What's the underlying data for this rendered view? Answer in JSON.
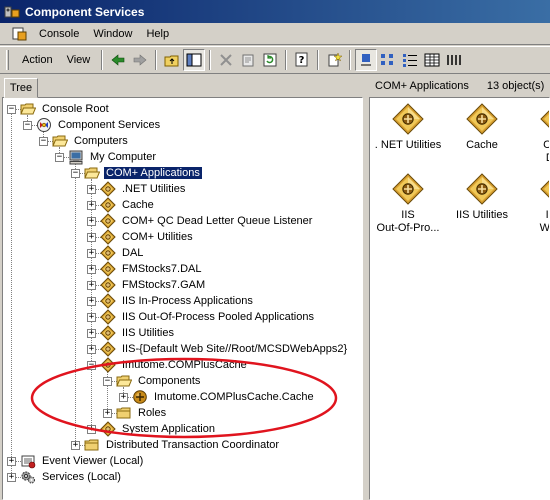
{
  "window": {
    "title": "Component Services"
  },
  "menubar": {
    "items": [
      "Console",
      "Window",
      "Help"
    ]
  },
  "toolbar": {
    "action_label": "Action",
    "view_label": "View"
  },
  "left_pane": {
    "tab_label": "Tree",
    "nodes": [
      {
        "label": "Console Root",
        "icon": "folder-open-icon"
      },
      {
        "label": "Component Services",
        "icon": "component-services-icon"
      },
      {
        "label": "Computers",
        "icon": "folder-open-icon"
      },
      {
        "label": "My Computer",
        "icon": "computer-icon"
      },
      {
        "label": "COM+ Applications",
        "icon": "folder-open-icon"
      },
      {
        "label": ".NET Utilities",
        "icon": "com-package-icon"
      },
      {
        "label": "Cache",
        "icon": "com-package-icon"
      },
      {
        "label": "COM+ QC Dead Letter Queue Listener",
        "icon": "com-package-icon"
      },
      {
        "label": "COM+ Utilities",
        "icon": "com-package-icon"
      },
      {
        "label": "DAL",
        "icon": "com-package-icon"
      },
      {
        "label": "FMStocks7.DAL",
        "icon": "com-package-icon"
      },
      {
        "label": "FMStocks7.GAM",
        "icon": "com-package-icon"
      },
      {
        "label": "IIS In-Process Applications",
        "icon": "com-package-icon"
      },
      {
        "label": "IIS Out-Of-Process Pooled Applications",
        "icon": "com-package-icon"
      },
      {
        "label": "IIS Utilities",
        "icon": "com-package-icon"
      },
      {
        "label": "IIS-{Default Web Site//Root/MCSDWebApps2}",
        "icon": "com-package-icon"
      },
      {
        "label": "Imutome.COMPlusCache",
        "icon": "com-package-icon"
      },
      {
        "label": "Components",
        "icon": "folder-open-icon"
      },
      {
        "label": "Imutome.COMPlusCache.Cache",
        "icon": "component-ball-icon"
      },
      {
        "label": "Roles",
        "icon": "folder-icon"
      },
      {
        "label": "System Application",
        "icon": "com-package-icon"
      },
      {
        "label": "Distributed Transaction Coordinator",
        "icon": "folder-icon"
      },
      {
        "label": "Event Viewer (Local)",
        "icon": "event-viewer-icon"
      },
      {
        "label": "Services (Local)",
        "icon": "services-gear-icon"
      }
    ]
  },
  "right_pane": {
    "header_title": "COM+ Applications",
    "header_count": "13 object(s)",
    "items": [
      {
        "line1": ". NET Utilities",
        "line2": ""
      },
      {
        "line1": "Cache",
        "line2": ""
      },
      {
        "line1": "COM",
        "line2": "Dea"
      },
      {
        "line1": "IIS",
        "line2": "Out-Of-Pro..."
      },
      {
        "line1": "IIS Utilities",
        "line2": ""
      },
      {
        "line1": "IIS-{",
        "line2": "Web S"
      }
    ]
  },
  "colors": {
    "titlebar_start": "#0a246a",
    "titlebar_end": "#3a6ea5",
    "selection": "#0a246a",
    "annotation_ellipse": "#e0141e",
    "window_face": "#d4d0c8"
  }
}
